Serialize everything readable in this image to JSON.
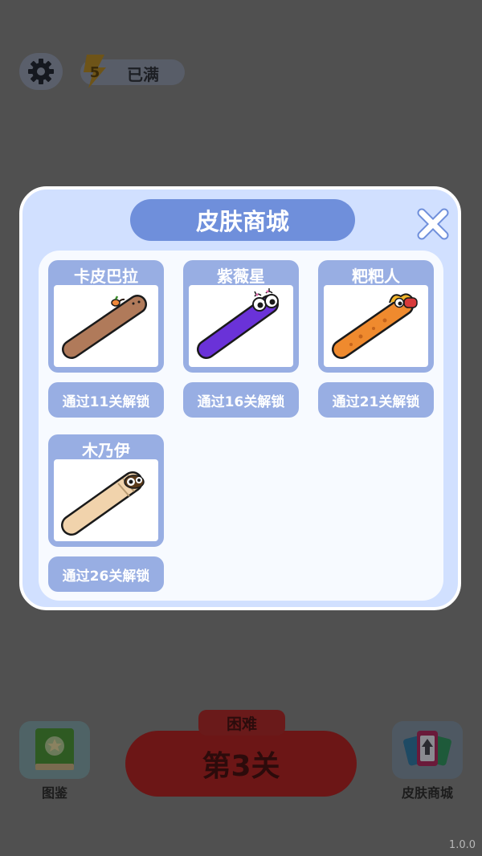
{
  "hud": {
    "settings_icon": "gear-icon",
    "energy_count": "5",
    "energy_status": "已满"
  },
  "bottom": {
    "gallery_label": "图鉴",
    "difficulty_label": "困难",
    "level_label": "第3关",
    "shop_label": "皮肤商城"
  },
  "version": "1.0.0",
  "modal": {
    "title": "皮肤商城",
    "close_icon": "close-icon",
    "skins": [
      {
        "name": "卡皮巴拉",
        "unlock": "通过11关解锁",
        "color": "#b07a5a"
      },
      {
        "name": "紫薇星",
        "unlock": "通过16关解锁",
        "color": "#6a32d8"
      },
      {
        "name": "粑粑人",
        "unlock": "通过21关解锁",
        "color": "#ef8a2e"
      },
      {
        "name": "木乃伊",
        "unlock": "通过26关解锁",
        "color": "#f1d3ac"
      }
    ]
  }
}
